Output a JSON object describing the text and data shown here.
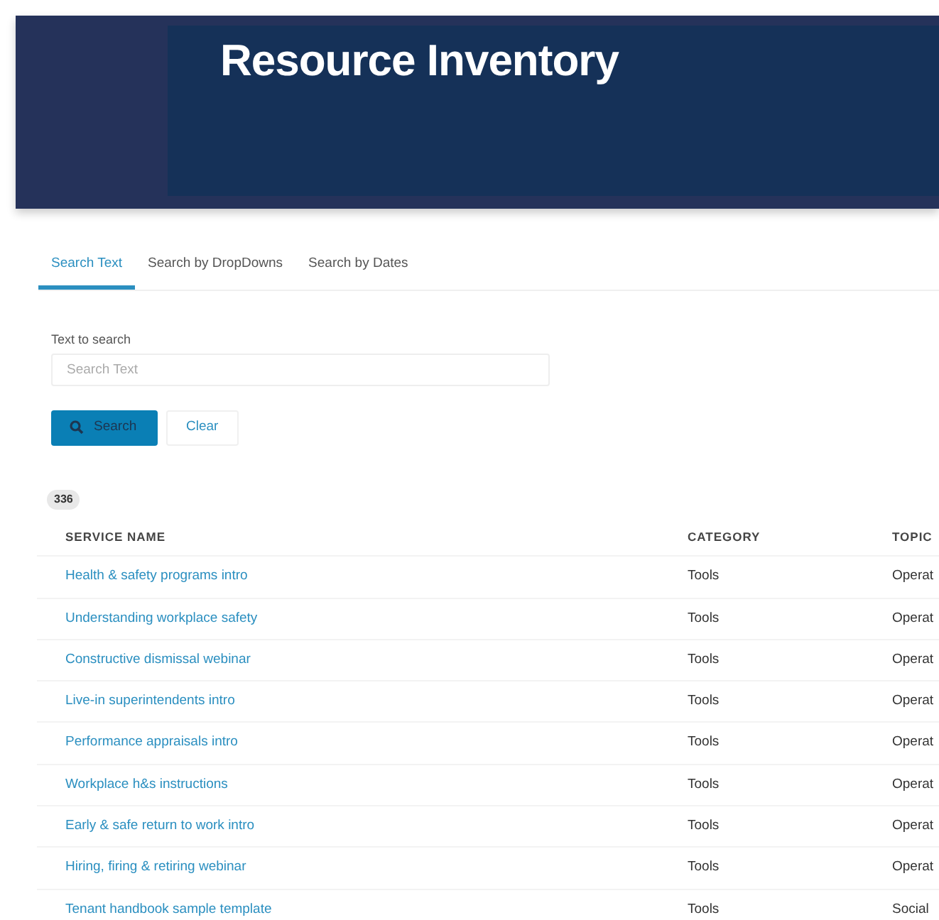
{
  "header": {
    "title": "Resource Inventory"
  },
  "tabs": [
    {
      "label": "Search Text",
      "selected": true
    },
    {
      "label": "Search by DropDowns",
      "selected": false
    },
    {
      "label": "Search by Dates",
      "selected": false
    }
  ],
  "search": {
    "label": "Text to search",
    "placeholder": "Search Text"
  },
  "buttons": [
    {
      "label": "Search",
      "kind": "primary"
    },
    {
      "label": "Clear",
      "kind": "secondary"
    }
  ],
  "result_count": "336",
  "table": {
    "columns": [
      "SERVICE NAME",
      "CATEGORY",
      "TOPIC"
    ],
    "rows": [
      [
        "Health & safety programs intro",
        "Tools",
        "Operat"
      ],
      [
        "Understanding workplace safety",
        "Tools",
        "Operat"
      ],
      [
        "Constructive dismissal webinar",
        "Tools",
        "Operat"
      ],
      [
        "Live-in superintendents intro",
        "Tools",
        "Operat"
      ],
      [
        "Performance appraisals intro",
        "Tools",
        "Operat"
      ],
      [
        "Workplace h&s instructions",
        "Tools",
        "Operat"
      ],
      [
        "Early & safe return to work intro",
        "Tools",
        "Operat"
      ],
      [
        "Hiring, firing & retiring webinar",
        "Tools",
        "Operat"
      ],
      [
        "Tenant handbook sample template",
        "Tools",
        "Social"
      ]
    ]
  }
}
